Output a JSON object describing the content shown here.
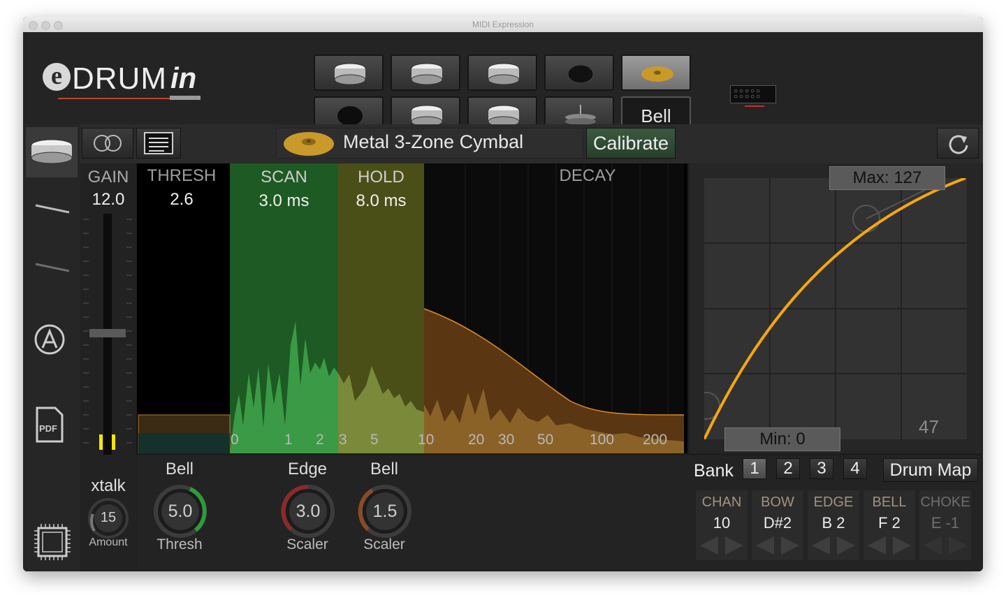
{
  "window": {
    "title": "MIDI Expression"
  },
  "logo": {
    "e": "e",
    "drum": "DRUM",
    "in": "in"
  },
  "pad_selector": {
    "selected_label": "Bell"
  },
  "toolbar": {
    "pad_name": "Metal 3-Zone Cymbal",
    "calibrate_label": "Calibrate"
  },
  "params": {
    "gain": {
      "label": "GAIN",
      "value": "12.0"
    },
    "thresh": {
      "label": "THRESH",
      "value": "2.6"
    },
    "scan": {
      "label": "SCAN",
      "value": "3.0 ms"
    },
    "hold": {
      "label": "HOLD",
      "value": "8.0 ms"
    },
    "decay": {
      "label": "DECAY"
    }
  },
  "time_axis": {
    "ticks": [
      "0",
      "1",
      "2",
      "3",
      "5",
      "10",
      "20",
      "30",
      "50",
      "100",
      "200"
    ]
  },
  "velocity_curve": {
    "max_label": "Max: 127",
    "min_label": "Min: 0",
    "current_value": "47"
  },
  "xtalk": {
    "label": "xtalk",
    "value": "15",
    "sub_label": "Amount"
  },
  "knobs": [
    {
      "top": "Bell",
      "value": "5.0",
      "bottom": "Thresh",
      "ring_color": "#2f9a3a"
    },
    {
      "top": "Edge",
      "value": "3.0",
      "bottom": "Scaler",
      "ring_color": "#8a2a2a"
    },
    {
      "top": "Bell",
      "value": "1.5",
      "bottom": "Scaler",
      "ring_color": "#8a4a2a"
    }
  ],
  "bank": {
    "label": "Bank",
    "options": [
      "1",
      "2",
      "3",
      "4"
    ],
    "selected": "1",
    "drum_map_label": "Drum Map"
  },
  "notes": [
    {
      "header": "CHAN",
      "value": "10"
    },
    {
      "header": "BOW",
      "value": "D#2"
    },
    {
      "header": "EDGE",
      "value": "B 2"
    },
    {
      "header": "BELL",
      "value": "F 2"
    },
    {
      "header": "CHOKE",
      "value": "E -1"
    }
  ],
  "colors": {
    "scan": "#2e7d32",
    "hold": "#6b7320",
    "decay": "#8a5a20",
    "curve": "#f5a70f"
  }
}
